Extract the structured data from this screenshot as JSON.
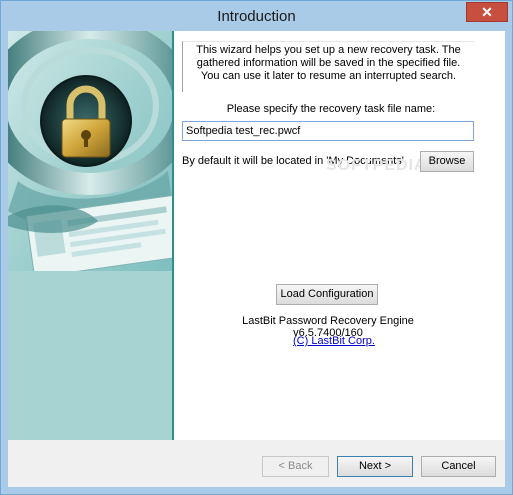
{
  "window": {
    "title": "Introduction",
    "close_symbol": "✕"
  },
  "intro": {
    "info_text": "This wizard helps you set up a new recovery task. The gathered information will be saved in the specified file. You can use it later to resume an interrupted search.",
    "file_label": "Please specify the recovery task file name:",
    "file_value": "Softpedia test_rec.pwcf",
    "default_location": "By default it will be located in 'My Documents'",
    "browse_label": "Browse",
    "load_label": "Load Configuration",
    "engine_text": "LastBit Password Recovery Engine v6.5.7400/160",
    "corp_link": "(C) LastBit Corp."
  },
  "footer": {
    "back_label": "< Back",
    "next_label": "Next >",
    "cancel_label": "Cancel"
  },
  "watermark": "SOFTPEDIA",
  "art": {
    "icon": "padlock-icon",
    "colors": {
      "teal": "#a8d3d3",
      "dark_teal": "#2f8f8f",
      "gold": "#d8b44a"
    }
  }
}
